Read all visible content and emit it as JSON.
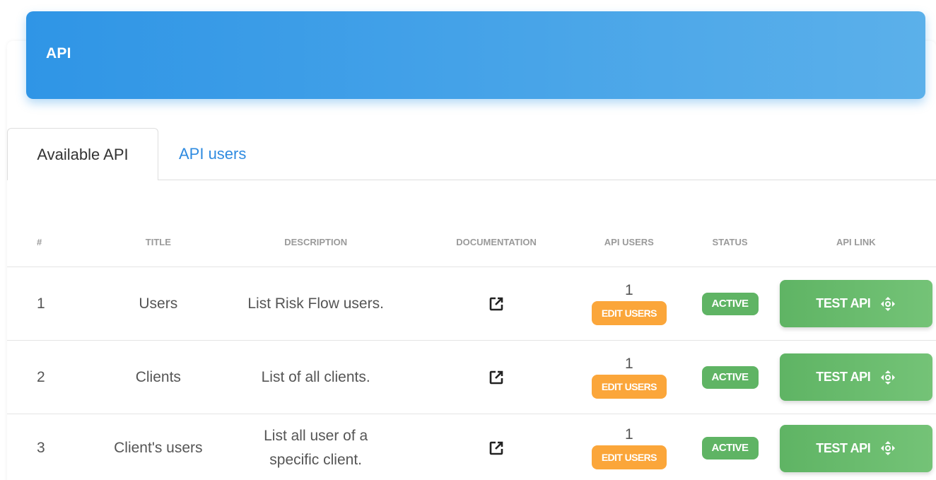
{
  "header": {
    "title": "API"
  },
  "tabs": [
    {
      "label": "Available API",
      "active": true
    },
    {
      "label": "API users",
      "active": false
    }
  ],
  "table": {
    "columns": [
      "#",
      "TITLE",
      "DESCRIPTION",
      "DOCUMENTATION",
      "API USERS",
      "STATUS",
      "API LINK"
    ],
    "rows": [
      {
        "num": "1",
        "title": "Users",
        "description": [
          "List Risk Flow users."
        ],
        "doc_icon": "external-link-icon",
        "api_users": "1",
        "edit_label": "EDIT USERS",
        "status": "ACTIVE",
        "link_label": "TEST API"
      },
      {
        "num": "2",
        "title": "Clients",
        "description": [
          "List of all clients."
        ],
        "doc_icon": "external-link-icon",
        "api_users": "1",
        "edit_label": "EDIT USERS",
        "status": "ACTIVE",
        "link_label": "TEST API"
      },
      {
        "num": "3",
        "title": "Client's users",
        "description": [
          "List all user of a",
          "specific client."
        ],
        "doc_icon": "external-link-icon",
        "api_users": "1",
        "edit_label": "EDIT USERS",
        "status": "ACTIVE",
        "link_label": "TEST API"
      }
    ]
  },
  "colors": {
    "header_start": "#2f95e6",
    "header_end": "#5bb0ea",
    "tab_link": "#2f8be0",
    "edit_button": "#fba63a",
    "status_active": "#5fb464",
    "test_button": "#5fb464"
  }
}
